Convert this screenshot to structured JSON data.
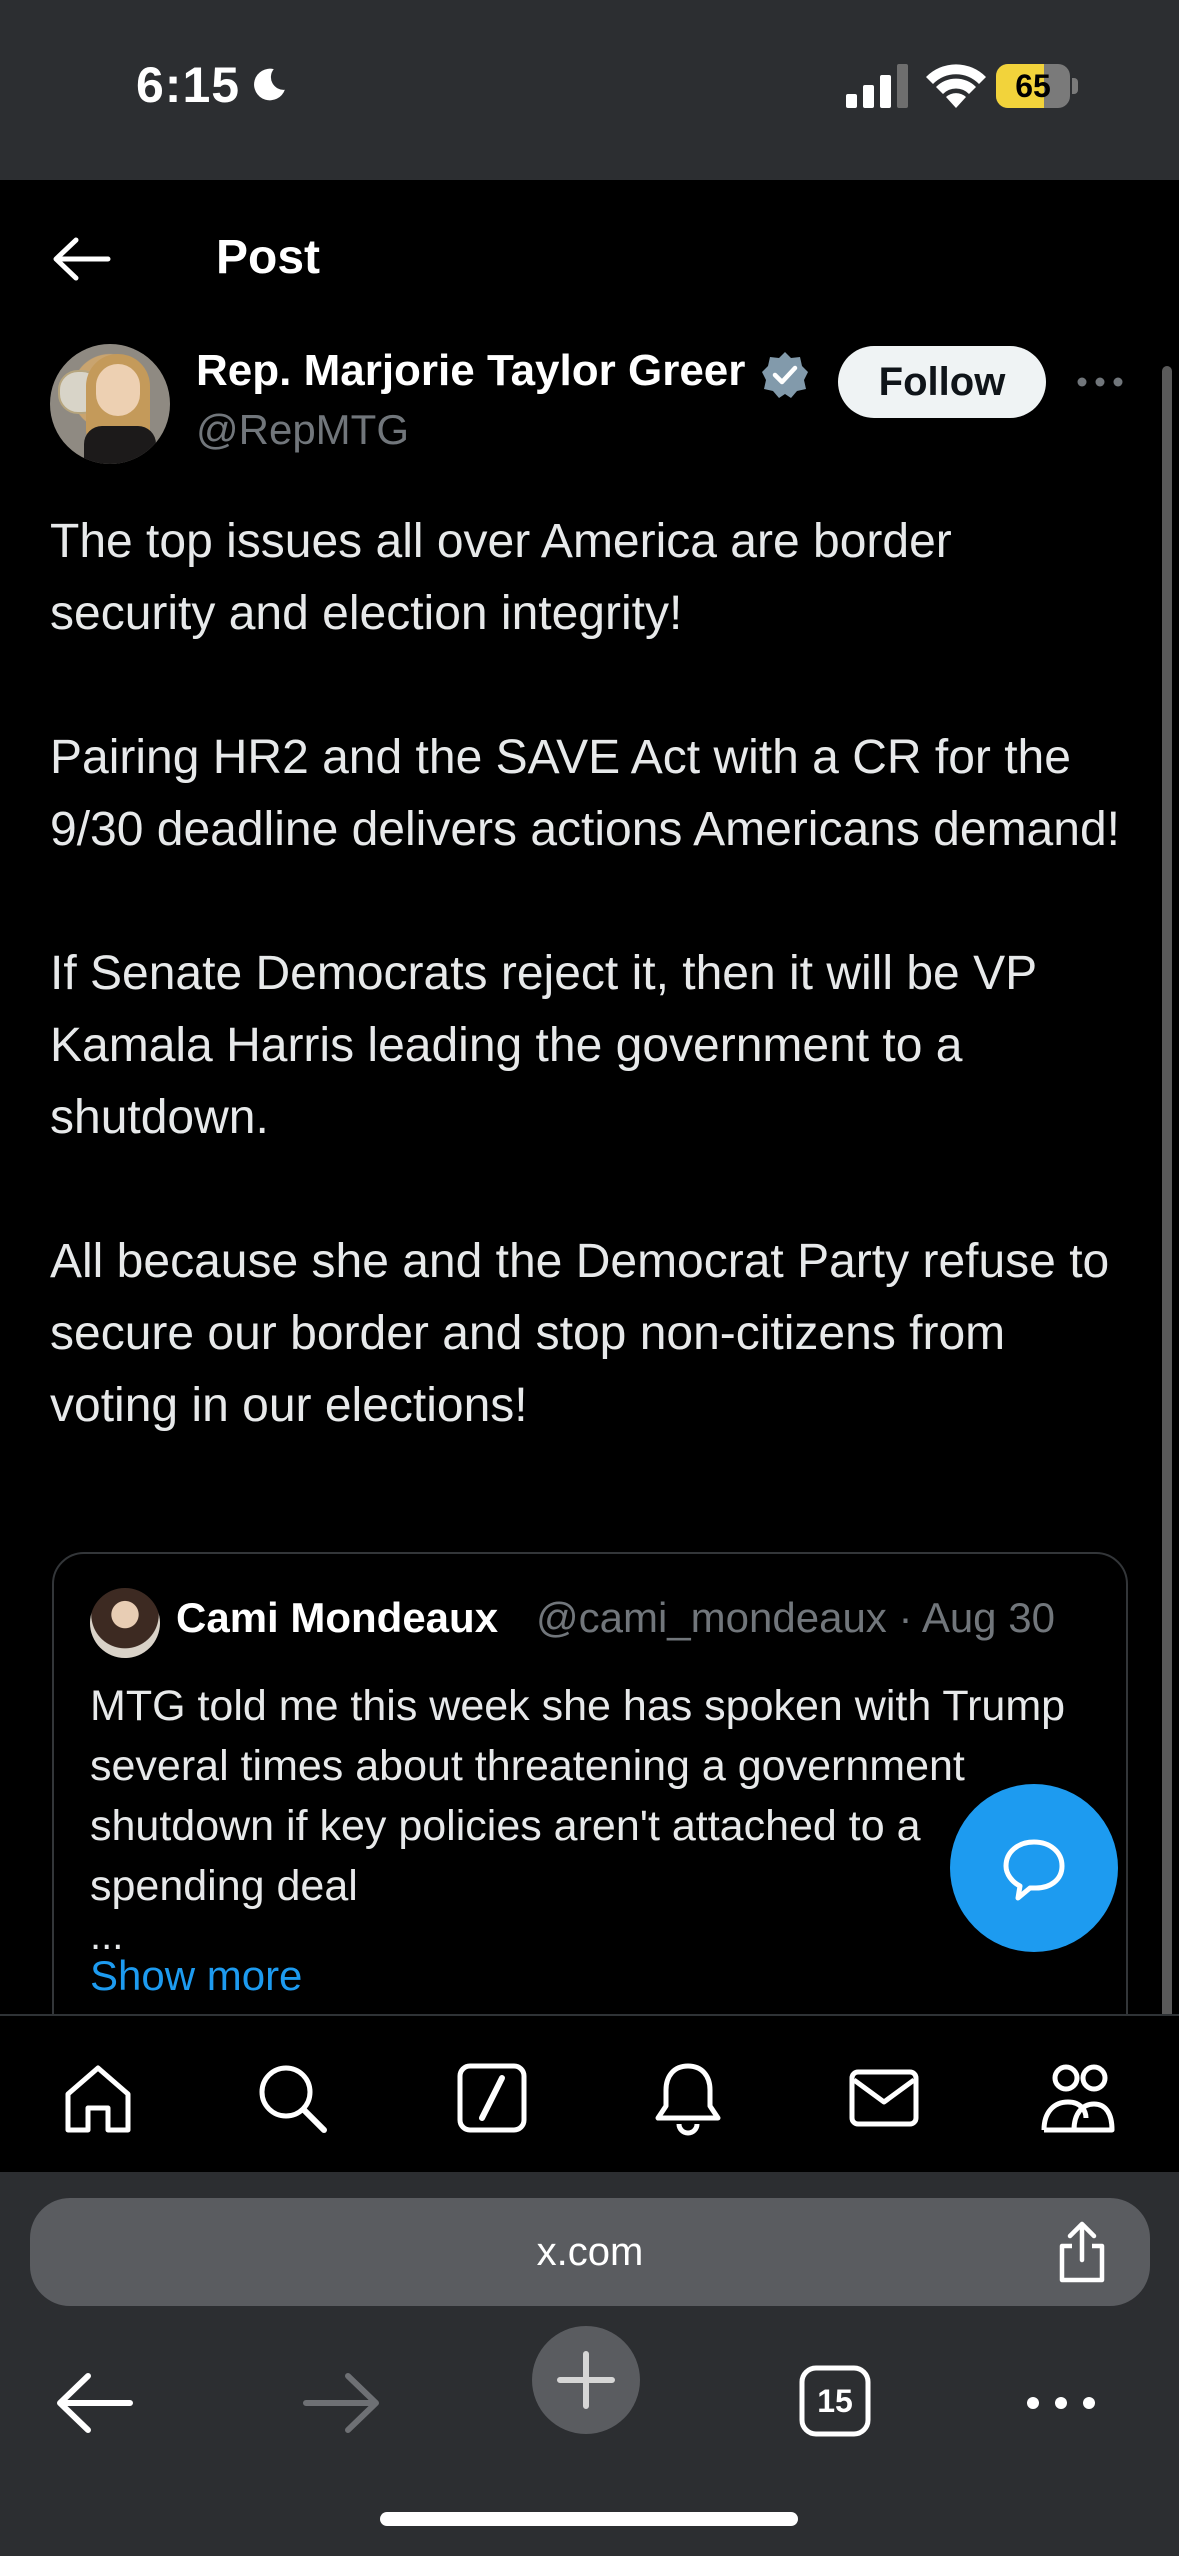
{
  "status_bar": {
    "time": "6:15",
    "battery_percent": "65",
    "battery_level": 0.65
  },
  "header": {
    "title": "Post"
  },
  "post": {
    "author_name": "Rep. Marjorie Taylor Greer",
    "author_handle": "@RepMTG",
    "follow_label": "Follow",
    "text": "The top issues all over America are border security and election integrity!\n\nPairing HR2 and the SAVE Act with a CR for the 9/30 deadline delivers actions Americans demand!\n\nIf Senate Democrats reject it, then it will be VP Kamala Harris leading the government to a shutdown.\n\nAll because she and the Democrat Party refuse to secure our border and stop non-citizens from voting in our elections!"
  },
  "quote": {
    "author_name": "Cami Mondeaux",
    "author_handle": "@cami_mondeaux · Aug 30",
    "text": "MTG told me this week she has spoken with Trump several times about threatening a government shutdown if key policies aren't attached to a spending deal",
    "ellipsis": "...",
    "show_more": "Show more"
  },
  "tab_bar": {
    "icons": [
      "home-icon",
      "search-icon",
      "grok-icon",
      "notifications-icon",
      "messages-icon",
      "communities-icon"
    ]
  },
  "browser": {
    "url": "x.com",
    "tab_count": "15"
  },
  "colors": {
    "accent": "#1d9bf0",
    "background": "#000000",
    "secondary_text": "#71767b",
    "verified": "#829aab"
  }
}
